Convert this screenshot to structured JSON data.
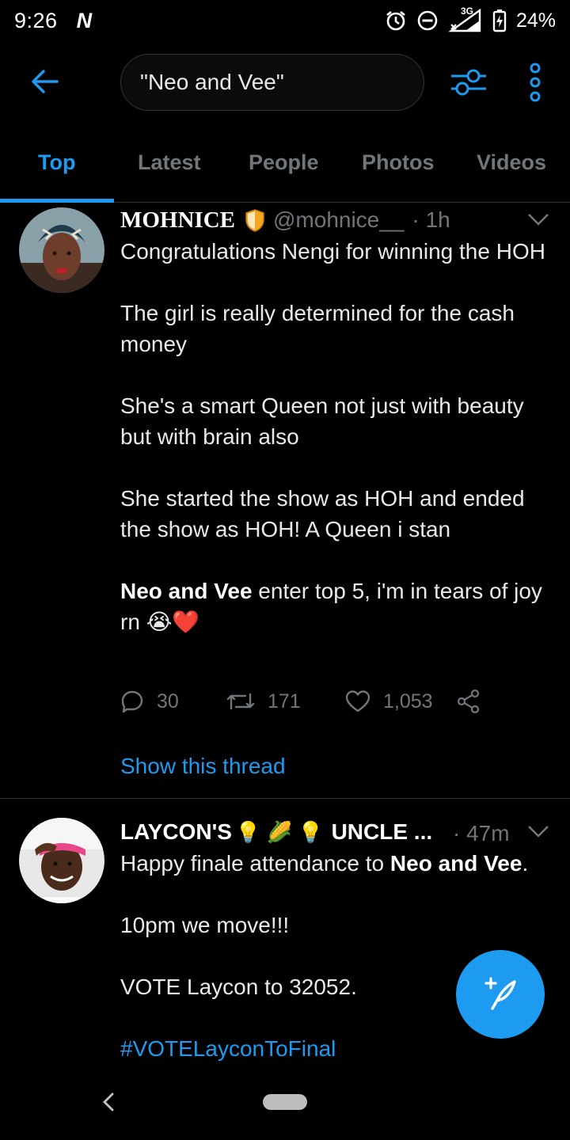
{
  "status_bar": {
    "time": "9:26",
    "app_badge": "N",
    "network": "3G",
    "battery": "24%",
    "icons": [
      "alarm-icon",
      "do-not-disturb-icon",
      "signal-icon",
      "battery-charging-icon"
    ]
  },
  "header": {
    "search_query": "\"Neo and Vee\"",
    "icons": [
      "back-arrow-icon",
      "filter-sliders-icon",
      "more-vertical-icon"
    ]
  },
  "tabs": [
    {
      "label": "Top",
      "active": true
    },
    {
      "label": "Latest",
      "active": false
    },
    {
      "label": "People",
      "active": false
    },
    {
      "label": "Photos",
      "active": false
    },
    {
      "label": "Videos",
      "active": false
    }
  ],
  "tweets": [
    {
      "display_name": "MOHNICE",
      "badge": "shield-emoji",
      "handle": "@mohnice__",
      "time": "· 1h",
      "body": {
        "p1": "Congratulations Nengi for winning the HOH",
        "p2": "The girl is really determined for the cash money",
        "p3": "She's a smart Queen not just with beauty but with brain also",
        "p4": "She started the show as HOH and ended the show as HOH! A Queen i stan",
        "p5_bold": "Neo and Vee",
        "p5_rest": " enter top 5, i'm in tears of joy rn",
        "p5_emoji": "😭❤️"
      },
      "replies": "30",
      "retweets": "171",
      "likes": "1,053",
      "show_thread": "Show this thread"
    },
    {
      "display_name_start": "LAYCON'S",
      "display_name_emojis": "💡 🌽 💡",
      "display_name_end": "UNCLE ...",
      "time": "· 47m",
      "body": {
        "p1_start": "Happy finale attendance to ",
        "p1_bold": "Neo and Vee",
        "p1_end": ".",
        "p2": "10pm we move!!!",
        "p3": "VOTE Laycon to 32052.",
        "p4_hashtag": "#VOTELayconToFinal"
      }
    }
  ],
  "colors": {
    "background": "#000000",
    "accent": "#1d9bf0",
    "muted": "#71767b",
    "divider": "#2f3336",
    "heart_red": "#e0245e"
  }
}
